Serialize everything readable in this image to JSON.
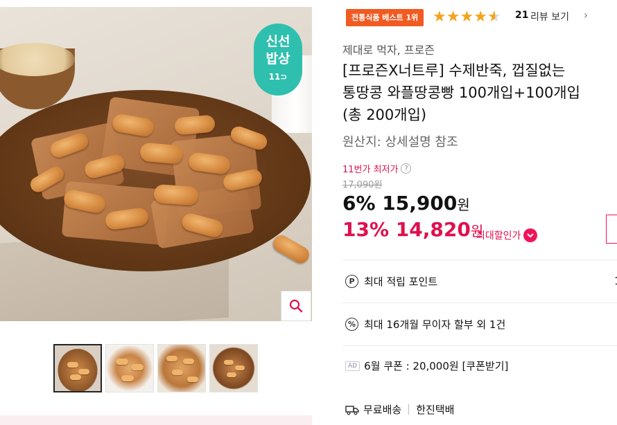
{
  "gallery": {
    "fresh_badge": {
      "line1": "신선",
      "line2": "밥상",
      "line3": "11⊃"
    },
    "zoom_icon": "magnifier-icon",
    "thumbnails": [
      {
        "name": "thumbnail-1",
        "active": true
      },
      {
        "name": "thumbnail-2",
        "active": false
      },
      {
        "name": "thumbnail-3",
        "active": false
      },
      {
        "name": "thumbnail-4",
        "active": false
      }
    ]
  },
  "product": {
    "best_badge": "전통식품 베스트 1위",
    "rating": 4.5,
    "review_count": "21",
    "review_link": "리뷰 보기",
    "seller": "제대로 먹자, 프로즌",
    "title_line1": "[프로즌X너트루] 수제반죽, 껍질없는",
    "title_line2": "통땅콩 와플땅콩빵 100개입+100개입",
    "title_line3": "(총 200개입)",
    "origin": "원산지: 상세설명 참조"
  },
  "pricing": {
    "lowest_label": "11번가 최저가",
    "help_icon": "?",
    "original_price": "17,090원",
    "discount1_pct": "6%",
    "discount1_price": "15,900",
    "won": "원",
    "discount2_pct": "13%",
    "discount2_price": "14,820",
    "max_discount_label": "최대할인가",
    "accent_color": "#e0104e"
  },
  "benefits": {
    "points_icon": "P",
    "points_label": "최대 적립 포인트",
    "points_value": "1",
    "installment_icon": "%",
    "installment_label": "최대 16개월 무이자 할부 외 1건",
    "ad_tag": "AD",
    "coupon_label": "6월 쿠폰 : 20,000원 [쿠폰받기]",
    "shipping_label": "무료배송",
    "courier": "한진택배"
  }
}
